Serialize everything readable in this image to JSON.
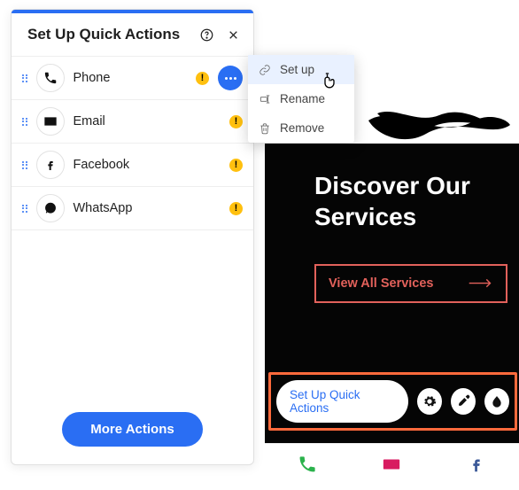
{
  "panel": {
    "title": "Set Up Quick Actions",
    "actions": [
      {
        "label": "Phone"
      },
      {
        "label": "Email"
      },
      {
        "label": "Facebook"
      },
      {
        "label": "WhatsApp"
      }
    ],
    "more_actions_label": "More Actions"
  },
  "context_menu": {
    "setup": "Set up",
    "rename": "Rename",
    "remove": "Remove"
  },
  "preview": {
    "heading": "Discover Our Services",
    "view_all_label": "View All Services",
    "qa_pill_label": "Set Up Quick Actions"
  },
  "colors": {
    "primary": "#2a6ef3",
    "warn": "#ffc00f",
    "highlight": "#ff6a3c",
    "accent_red": "#e2615b",
    "hot_pink": "#d81b60",
    "green": "#2bb24c"
  }
}
